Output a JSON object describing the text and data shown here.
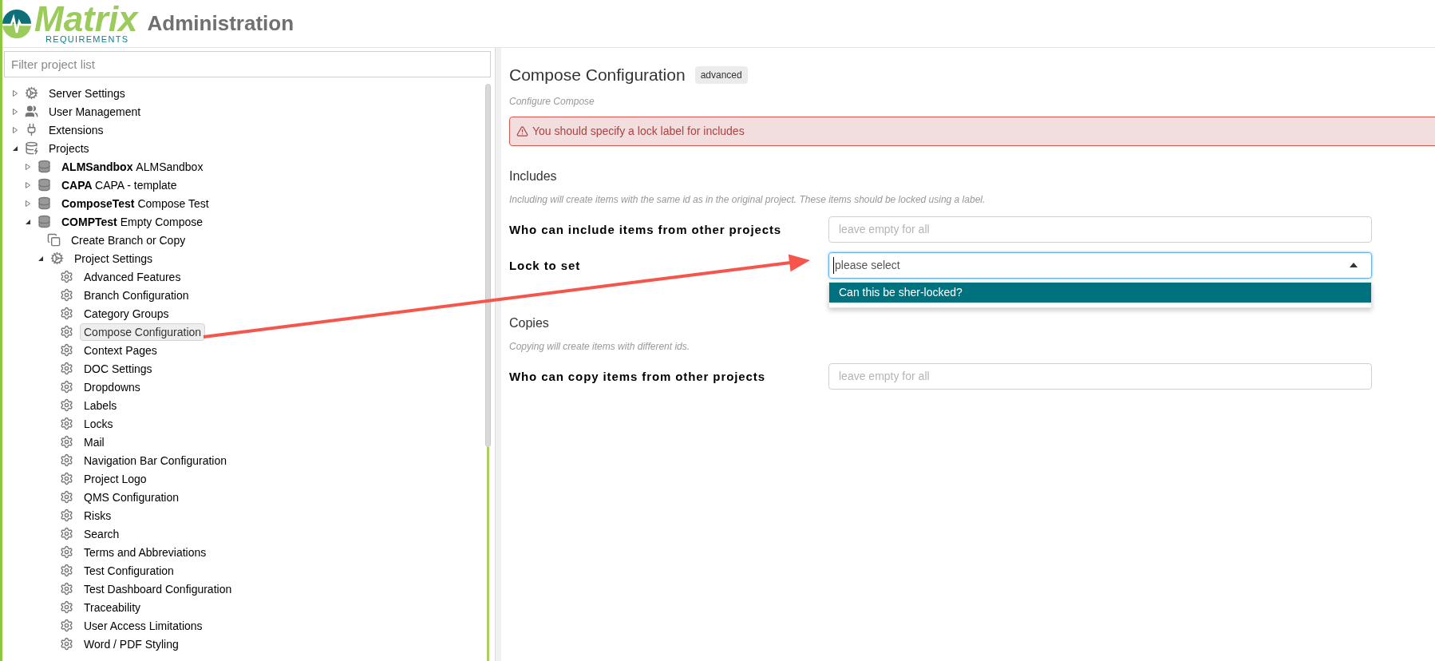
{
  "header": {
    "logo_word": "Matrix",
    "logo_subword": "REQUIREMENTS",
    "title": "Administration"
  },
  "sidebar": {
    "filter": {
      "placeholder": "Filter project list"
    },
    "tree": [
      {
        "kind": "gears",
        "label": "Server Settings",
        "expanded": false,
        "selected": false
      },
      {
        "kind": "users",
        "label": "User Management",
        "expanded": false,
        "selected": false
      },
      {
        "kind": "plug",
        "label": "Extensions",
        "expanded": false,
        "selected": false
      },
      {
        "kind": "database-gear",
        "label": "Projects",
        "expanded": true,
        "selected": false,
        "children": [
          {
            "kind": "database",
            "code": "ALMSandbox",
            "label": "ALMSandbox",
            "expanded": false,
            "selected": false
          },
          {
            "kind": "database",
            "code": "CAPA",
            "label": "CAPA - template",
            "expanded": false,
            "selected": false
          },
          {
            "kind": "database",
            "code": "ComposeTest",
            "label": "Compose Test",
            "expanded": false,
            "selected": false
          },
          {
            "kind": "database",
            "code": "COMPTest",
            "label": "Empty Compose",
            "expanded": true,
            "selected": false,
            "children": [
              {
                "kind": "copy",
                "label": "Create Branch or Copy",
                "selected": false
              },
              {
                "kind": "gears",
                "label": "Project Settings",
                "expanded": true,
                "selected": false,
                "children": [
                  {
                    "kind": "gear",
                    "label": "Advanced Features",
                    "selected": false
                  },
                  {
                    "kind": "gear",
                    "label": "Branch Configuration",
                    "selected": false
                  },
                  {
                    "kind": "gear",
                    "label": "Category Groups",
                    "selected": false
                  },
                  {
                    "kind": "gear",
                    "label": "Compose Configuration",
                    "selected": true
                  },
                  {
                    "kind": "gear",
                    "label": "Context Pages",
                    "selected": false
                  },
                  {
                    "kind": "gear",
                    "label": "DOC Settings",
                    "selected": false
                  },
                  {
                    "kind": "gear",
                    "label": "Dropdowns",
                    "selected": false
                  },
                  {
                    "kind": "gear",
                    "label": "Labels",
                    "selected": false
                  },
                  {
                    "kind": "gear",
                    "label": "Locks",
                    "selected": false
                  },
                  {
                    "kind": "gear",
                    "label": "Mail",
                    "selected": false
                  },
                  {
                    "kind": "gear",
                    "label": "Navigation Bar Configuration",
                    "selected": false
                  },
                  {
                    "kind": "gear",
                    "label": "Project Logo",
                    "selected": false
                  },
                  {
                    "kind": "gear",
                    "label": "QMS Configuration",
                    "selected": false
                  },
                  {
                    "kind": "gear",
                    "label": "Risks",
                    "selected": false
                  },
                  {
                    "kind": "gear",
                    "label": "Search",
                    "selected": false
                  },
                  {
                    "kind": "gear",
                    "label": "Terms and Abbreviations",
                    "selected": false
                  },
                  {
                    "kind": "gear",
                    "label": "Test Configuration",
                    "selected": false
                  },
                  {
                    "kind": "gear",
                    "label": "Test Dashboard Configuration",
                    "selected": false
                  },
                  {
                    "kind": "gear",
                    "label": "Traceability",
                    "selected": false
                  },
                  {
                    "kind": "gear",
                    "label": "User Access Limitations",
                    "selected": false
                  },
                  {
                    "kind": "gear",
                    "label": "Word / PDF Styling",
                    "selected": false
                  }
                ]
              }
            ]
          }
        ]
      }
    ]
  },
  "content": {
    "title": "Compose Configuration",
    "badge": "advanced",
    "subtitle": "Configure Compose",
    "alert": "You should specify a lock label for includes",
    "sections": [
      {
        "heading": "Includes",
        "description": "Including will create items with the same id as in the original project. These items should be locked using a label.",
        "fields": [
          {
            "kind": "text",
            "label": "Who can include items from other projects",
            "placeholder": "leave empty for all"
          },
          {
            "kind": "select",
            "label": "Lock to set",
            "value": "please select",
            "expanded": true,
            "options": [
              {
                "label": "Can this be sher-locked?",
                "selected": true
              }
            ]
          }
        ]
      },
      {
        "heading": "Copies",
        "description": "Copying will create items with different ids.",
        "fields": [
          {
            "kind": "text",
            "label": "Who can copy items from other projects",
            "placeholder": "leave empty for all"
          }
        ]
      }
    ]
  }
}
